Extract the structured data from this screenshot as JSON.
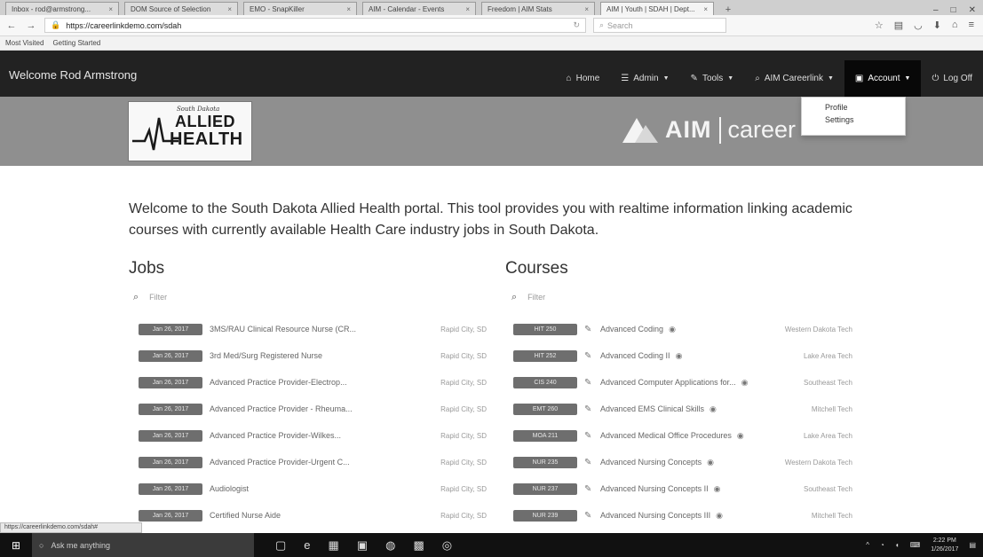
{
  "browser": {
    "tabs": [
      {
        "label": "Inbox - rod@armstrong...",
        "active": false
      },
      {
        "label": "DOM Source of Selection",
        "active": false
      },
      {
        "label": "EMO - SnapKiller",
        "active": false
      },
      {
        "label": "AIM - Calendar - Events",
        "active": false
      },
      {
        "label": "Freedom | AIM Stats",
        "active": false
      },
      {
        "label": "AIM | Youth | SDAH | Dept...",
        "active": true
      }
    ],
    "url": "https://careerlinkdemo.com/sdah",
    "url_host": "careerlinkdemo.com",
    "search_placeholder": "Search",
    "bookmarks": [
      "Most Visited",
      "Getting Started"
    ]
  },
  "appbar": {
    "welcome": "Welcome Rod Armstrong",
    "nav": [
      {
        "label": "Home",
        "icon": "home-icon",
        "caret": false
      },
      {
        "label": "Admin",
        "icon": "list-icon",
        "caret": true
      },
      {
        "label": "Tools",
        "icon": "wrench-icon",
        "caret": true
      },
      {
        "label": "AIM Careerlink",
        "icon": "search-icon",
        "caret": true
      },
      {
        "label": "Account",
        "icon": "briefcase-icon",
        "caret": true,
        "open": true
      },
      {
        "label": "Log Off",
        "icon": "power-icon",
        "caret": false
      }
    ],
    "account_menu": [
      "Profile",
      "Settings"
    ]
  },
  "banner": {
    "logo_small": "South Dakota",
    "logo_line1": "ALLIED",
    "logo_line2": "HEALTH",
    "aim_text": "AIM",
    "career_text": "career"
  },
  "intro": "Welcome to the South Dakota Allied Health portal. This tool provides you with realtime information linking academic courses with currently available Health Care industry jobs in South Dakota.",
  "jobs": {
    "title": "Jobs",
    "search_placeholder": "Filter",
    "rows": [
      {
        "date": "Jan 26, 2017",
        "title": "3MS/RAU Clinical Resource Nurse (CR...",
        "location": "Rapid City, SD"
      },
      {
        "date": "Jan 26, 2017",
        "title": "3rd Med/Surg Registered Nurse",
        "location": "Rapid City, SD"
      },
      {
        "date": "Jan 26, 2017",
        "title": "Advanced Practice Provider-Electrop...",
        "location": "Rapid City, SD"
      },
      {
        "date": "Jan 26, 2017",
        "title": "Advanced Practice Provider - Rheuma...",
        "location": "Rapid City, SD"
      },
      {
        "date": "Jan 26, 2017",
        "title": "Advanced Practice Provider-Wilkes...",
        "location": "Rapid City, SD"
      },
      {
        "date": "Jan 26, 2017",
        "title": "Advanced Practice Provider-Urgent C...",
        "location": "Rapid City, SD"
      },
      {
        "date": "Jan 26, 2017",
        "title": "Audiologist",
        "location": "Rapid City, SD"
      },
      {
        "date": "Jan 26, 2017",
        "title": "Certified Nurse Aide",
        "location": "Rapid City, SD"
      }
    ]
  },
  "courses": {
    "title": "Courses",
    "search_placeholder": "Filter",
    "rows": [
      {
        "code": "HIT 250",
        "title": "Advanced Coding",
        "school": "Western Dakota Tech"
      },
      {
        "code": "HIT 252",
        "title": "Advanced Coding II",
        "school": "Lake Area Tech"
      },
      {
        "code": "CIS 240",
        "title": "Advanced Computer Applications for...",
        "school": "Southeast Tech"
      },
      {
        "code": "EMT 260",
        "title": "Advanced EMS Clinical Skills",
        "school": "Mitchell Tech"
      },
      {
        "code": "MOA 211",
        "title": "Advanced Medical Office Procedures",
        "school": "Lake Area Tech"
      },
      {
        "code": "NUR 235",
        "title": "Advanced Nursing Concepts",
        "school": "Western Dakota Tech"
      },
      {
        "code": "NUR 237",
        "title": "Advanced Nursing Concepts II",
        "school": "Southeast Tech"
      },
      {
        "code": "NUR 239",
        "title": "Advanced Nursing Concepts III",
        "school": "Mitchell Tech"
      }
    ]
  },
  "status_text": "https://careerlinkdemo.com/sdah#",
  "taskbar": {
    "cortana": "Ask me anything",
    "time": "2:22 PM",
    "date": "1/26/2017"
  },
  "colors": {
    "navbar": "#222222",
    "banner": "#8f8f8f",
    "badge": "#6e6e6e"
  }
}
